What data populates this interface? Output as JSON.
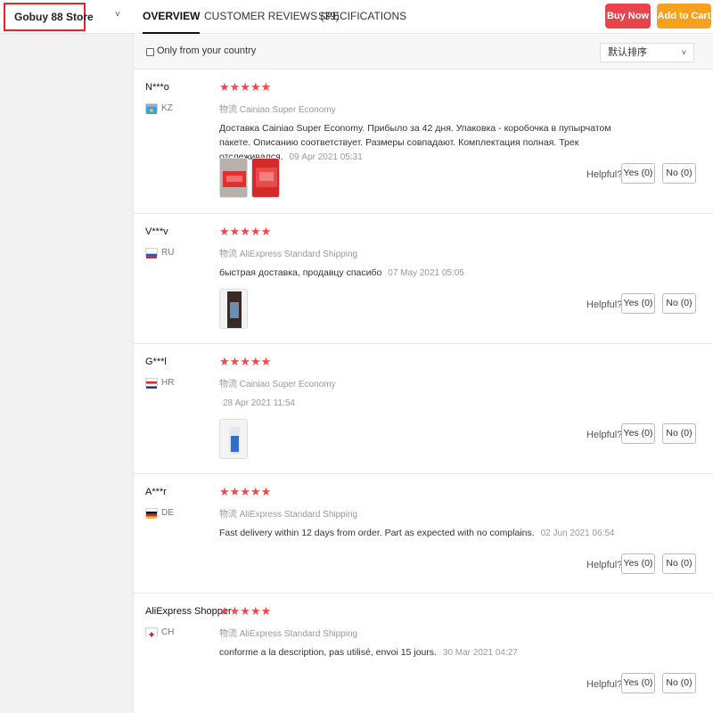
{
  "store": {
    "name": "Gobuy 88 Store",
    "chevron": "˅"
  },
  "tabs": [
    {
      "label": "OVERVIEW"
    },
    {
      "label": "CUSTOMER REVIEWS (39)"
    },
    {
      "label": "SPECIFICATIONS"
    }
  ],
  "actions": {
    "buy_now": "Buy Now",
    "add_to_cart": "Add to Cart",
    "buy_color": "#e8444b",
    "cart_color": "#f6a11e"
  },
  "filter": {
    "only_country": "Only from your country",
    "sort_label": "默认排序",
    "sort_chevron": "˅"
  },
  "reviews": [
    {
      "user": "N***o",
      "country": "KZ",
      "stars": "★★★★★",
      "ship_prefix": "物流",
      "shipping": "Cainiao Super Economy",
      "text": "Доставка Cainiao Super Economy. Прибыло за 42 дня. Упаковка - коробочка в пупырчатом пакете. Описанию соответствует. Размеры совпадают. Комплектация полная. Трек отслеживался.",
      "date": "09 Apr 2021 05:31",
      "helpful": "Helpful?",
      "yes": "Yes (0)",
      "no": "No (0)"
    },
    {
      "user": "V***v",
      "country": "RU",
      "stars": "★★★★★",
      "ship_prefix": "物流",
      "shipping": "AliExpress Standard Shipping",
      "text": "быстрая доставка, продавцу спасибо",
      "date": "07 May 2021 05:05",
      "helpful": "Helpful?",
      "yes": "Yes (0)",
      "no": "No (0)"
    },
    {
      "user": "G***l",
      "country": "HR",
      "stars": "★★★★★",
      "ship_prefix": "物流",
      "shipping": "Cainiao Super Economy",
      "text": "",
      "date": "28 Apr 2021 11:54",
      "helpful": "Helpful?",
      "yes": "Yes (0)",
      "no": "No (0)"
    },
    {
      "user": "A***r",
      "country": "DE",
      "stars": "★★★★★",
      "ship_prefix": "物流",
      "shipping": "AliExpress Standard Shipping",
      "text": "Fast delivery within 12 days from order. Part as expected with no complains.",
      "date": "02 Jun 2021 06:54",
      "helpful": "Helpful?",
      "yes": "Yes (0)",
      "no": "No (0)"
    },
    {
      "user": "AliExpress Shopper",
      "country": "CH",
      "stars": "★★★★★",
      "ship_prefix": "物流",
      "shipping": "AliExpress Standard Shipping",
      "text": "conforme a la description, pas utilisé, envoi 15 jours.",
      "date": "30 Mar 2021 04:27",
      "helpful": "Helpful?",
      "yes": "Yes (0)",
      "no": "No (0)"
    }
  ]
}
